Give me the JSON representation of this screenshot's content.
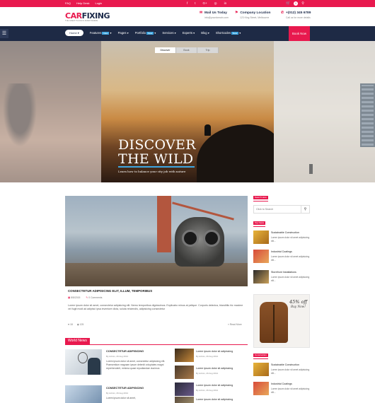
{
  "topbar": {
    "links": [
      "FAQ",
      "Help Desk",
      "Login"
    ],
    "social": [
      "f",
      "t",
      "G+",
      "◎",
      "in"
    ],
    "cart_count": "0"
  },
  "header": {
    "logo_part1": "CAR",
    "logo_part2": "FIXING",
    "tagline": "THE GREAT PLACE IN EVERYWHERE",
    "contact1_title": "Mail Us Today",
    "contact1_sub": "info@yourdomain.com",
    "contact2_title": "Company Location",
    "contact2_sub": "123 King Street, Melbourne",
    "contact3_title": "+(012) 345 6789",
    "contact3_sub": "Call us for more details"
  },
  "nav": {
    "home": "Home",
    "items": [
      {
        "label": "Features",
        "badge": "New"
      },
      {
        "label": "Pages",
        "badge": ""
      },
      {
        "label": "Portfolio",
        "badge": "New"
      },
      {
        "label": "Services",
        "badge": ""
      },
      {
        "label": "Experts",
        "badge": ""
      },
      {
        "label": "Blog",
        "badge": ""
      },
      {
        "label": "Shortcodes",
        "badge": "New"
      }
    ],
    "book_now": "Book Now"
  },
  "hero": {
    "tabs": [
      "Discover",
      "Book",
      "Trip"
    ],
    "title_line1": "DISCOVER",
    "title_line2": "THE WILD",
    "subtitle": "Learn how to balance your city job with nature"
  },
  "post": {
    "title": "CONSECTETUR ADIPISICING ELIT, ILLUM, TEMPORIBUS",
    "date": "8/8/2015",
    "comments": "0 Comments",
    "excerpt": "Lorem ipsum dolor sit amet, consectetur adipisicing elit. Nemo temporibus dignissimos. Explicabo minus at pelique. Corporis delectus, blanditiis hic maxime vel fugit modi ad adipisci ipsa inventore dicta, soluta reiciendis, adipisicing consectetur",
    "likes": "18",
    "views": "125",
    "read_more": "Read More"
  },
  "world_news": {
    "heading": "World News",
    "left_items": [
      {
        "title": "CONSECTETUR ADIPISICING",
        "meta": "By Admin, 29 Aug 2012",
        "text": "Lorem ipsum dolor sit amet, consectetur adipisicing elit. Praesentium magnam ipsum deleniti voluptates magni reprehenderit, minima quasi repudiandae ducimus"
      },
      {
        "title": "CONSECTETUR ADIPISICING",
        "meta": "By Admin, 29 Aug 2012",
        "text": "Lorem ipsum dolor sit amet,"
      }
    ],
    "right_items": [
      {
        "title": "Lorem ipsum dolor sit adipisicing",
        "meta": "By Admin, 29 Aug 2012"
      },
      {
        "title": "Lorem ipsum dolor sit adipisicing",
        "meta": "By Admin, 29 Aug 2012"
      },
      {
        "title": "Lorem ipsum dolor sit adipisicing",
        "meta": "By Admin, 29 Aug 2012"
      },
      {
        "title": "Lorem ipsum dolor sit adipisicing",
        "meta": "By Admin, 29 Aug 2012"
      }
    ]
  },
  "sidebar": {
    "search_label": "Search Here",
    "search_placeholder": "Click to Search",
    "top_news_label": "Top News",
    "top_news": [
      {
        "title": "Sustainable Construction",
        "text": "Lorem ipsum dolor sit amet adipisicing elit..."
      },
      {
        "title": "Industrial Coatings",
        "text": "Lorem ipsum dolor sit amet adipisicing elit..."
      },
      {
        "title": "Storefront Installations",
        "text": "Lorem ipsum dolor sit amet adipisicing elit..."
      }
    ],
    "ad_percent": "45% off",
    "ad_buy": "Buy Now!",
    "bottom_label": "Construction",
    "bottom_news": [
      {
        "title": "Sustainable Construction",
        "text": "Lorem ipsum dolor sit amet adipisicing elit..."
      },
      {
        "title": "Industrial Coatings",
        "text": "Lorem ipsum dolor sit amet adipisicing elit..."
      }
    ]
  },
  "colors": {
    "accent": "#e8194e",
    "navy": "#1e2a45",
    "badge": "#3ea6e0"
  }
}
